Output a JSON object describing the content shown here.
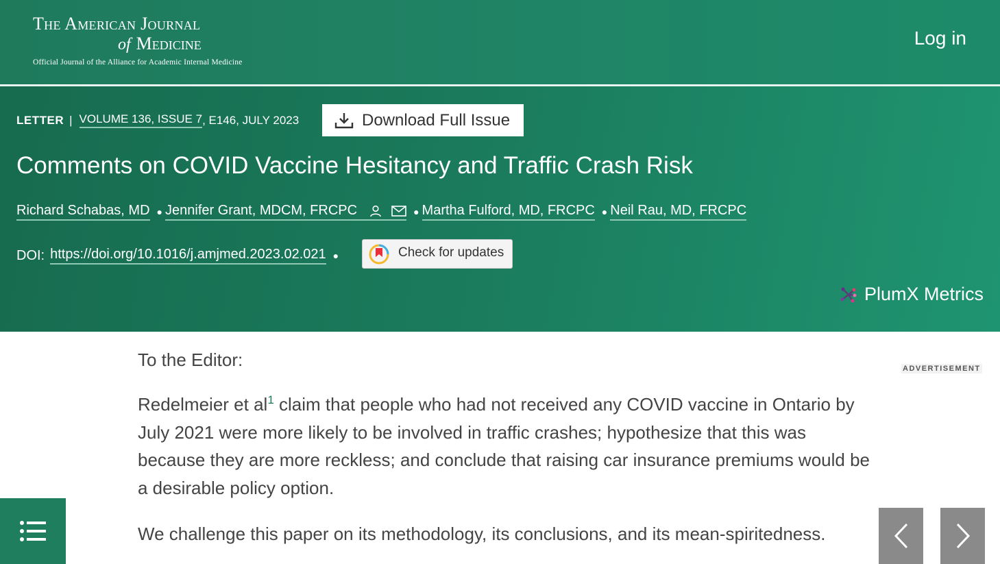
{
  "header": {
    "logo_line1": "The American Journal",
    "logo_of": "of",
    "logo_line2": "Medicine",
    "logo_tagline": "Official Journal of the Alliance for Academic Internal Medicine",
    "login_label": "Log in"
  },
  "article": {
    "type": "LETTER",
    "separator": "|",
    "volume_link": "VOLUME 136, ISSUE 7",
    "volume_rest": ", E146, JULY 2023",
    "download_label": "Download Full Issue",
    "title": "Comments on COVID Vaccine Hesitancy and Traffic Crash Risk",
    "authors": [
      "Richard Schabas, MD",
      "Jennifer Grant, MDCM, FRCPC",
      "Martha Fulford, MD, FRCPC",
      "Neil Rau, MD, FRCPC"
    ],
    "doi_label": "DOI:",
    "doi_url": "https://doi.org/10.1016/j.amjmed.2023.02.021",
    "check_updates_label": "Check for updates",
    "plumx_label": "PlumX Metrics"
  },
  "body": {
    "salutation": "To the Editor:",
    "para1_start": "Redelmeier et al",
    "para1_ref": "1",
    "para1_rest": " claim that people who had not received any COVID vaccine in Ontario by July 2021 were more likely to be involved in traffic crashes; hypothesize that this was because they are more reckless; and conclude that raising car insurance premiums would be a desirable policy option.",
    "para2": "We challenge this paper on its methodology, its conclusions, and its mean-spiritedness."
  },
  "sidebar": {
    "ad_label": "ADVERTISEMENT"
  },
  "colors": {
    "brand_green": "#1e7e5d",
    "link_underline": "#8fc8b3",
    "nav_gray": "#8a8a8a"
  }
}
